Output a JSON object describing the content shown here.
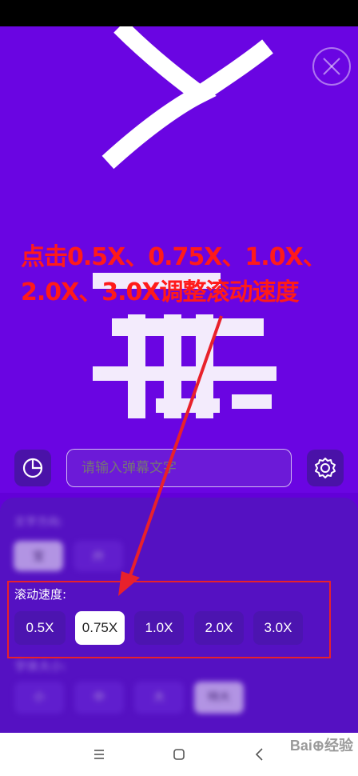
{
  "annotation": {
    "line1": "点击0.5X、0.75X、1.0X、",
    "line2": "2.0X、3.0X调整滚动速度"
  },
  "input": {
    "placeholder": "请输入弹幕文字"
  },
  "direction": {
    "label": "文字方向:",
    "options": [
      "宝",
      "廾"
    ]
  },
  "speed": {
    "label": "滚动速度:",
    "options": [
      "0.5X",
      "0.75X",
      "1.0X",
      "2.0X",
      "3.0X"
    ],
    "selected": "0.75X"
  },
  "size": {
    "label": "字体大小:",
    "options": [
      "小",
      "中",
      "大",
      "特大"
    ],
    "selected": "特大"
  },
  "watermark": "Bai⊕经验",
  "colors": {
    "accent": "#6a05e2",
    "annotation": "#ff1a1a"
  }
}
